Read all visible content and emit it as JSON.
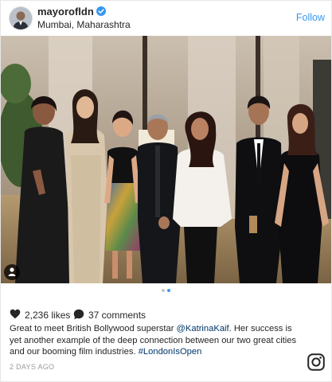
{
  "post": {
    "username": "mayorofldn",
    "location": "Mumbai, Maharashtra",
    "follow_label": "Follow",
    "likes": "2,236 likes",
    "comments": "37 comments",
    "caption": {
      "part1": "Great to meet British Bollywood superstar ",
      "mention": "@KatrinaKaif",
      "part2": ". Her success is yet another example of the deep connection between our two great cities and our booming film industries. ",
      "hashtag": "#LondonIsOpen"
    },
    "timestamp": "2 DAYS AGO",
    "carousel": {
      "count": 2,
      "active_index": 1
    }
  },
  "icons": {
    "verified": "verified-badge-icon",
    "like": "heart-icon",
    "comment": "comment-bubble-icon",
    "brand": "instagram-icon",
    "tagged": "person-tag-icon"
  },
  "colors": {
    "link": "#3897f0",
    "mention": "#003569",
    "text": "#262626",
    "muted": "#999999"
  }
}
